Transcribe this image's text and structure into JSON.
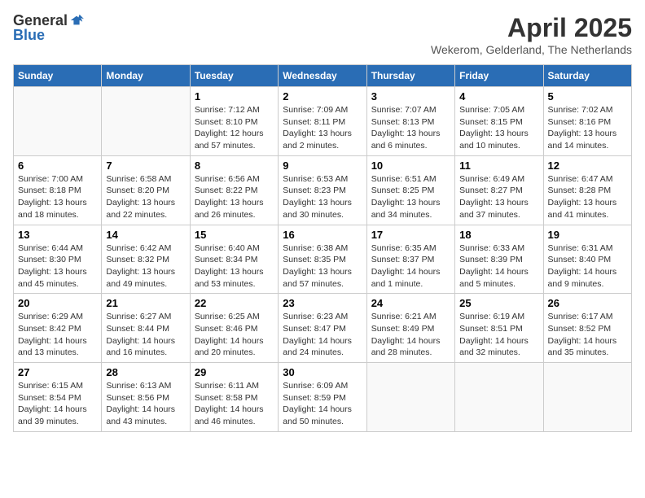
{
  "logo": {
    "general": "General",
    "blue": "Blue"
  },
  "title": "April 2025",
  "subtitle": "Wekerom, Gelderland, The Netherlands",
  "weekdays": [
    "Sunday",
    "Monday",
    "Tuesday",
    "Wednesday",
    "Thursday",
    "Friday",
    "Saturday"
  ],
  "weeks": [
    [
      {
        "day": "",
        "sunrise": "",
        "sunset": "",
        "daylight": ""
      },
      {
        "day": "",
        "sunrise": "",
        "sunset": "",
        "daylight": ""
      },
      {
        "day": "1",
        "sunrise": "Sunrise: 7:12 AM",
        "sunset": "Sunset: 8:10 PM",
        "daylight": "Daylight: 12 hours and 57 minutes."
      },
      {
        "day": "2",
        "sunrise": "Sunrise: 7:09 AM",
        "sunset": "Sunset: 8:11 PM",
        "daylight": "Daylight: 13 hours and 2 minutes."
      },
      {
        "day": "3",
        "sunrise": "Sunrise: 7:07 AM",
        "sunset": "Sunset: 8:13 PM",
        "daylight": "Daylight: 13 hours and 6 minutes."
      },
      {
        "day": "4",
        "sunrise": "Sunrise: 7:05 AM",
        "sunset": "Sunset: 8:15 PM",
        "daylight": "Daylight: 13 hours and 10 minutes."
      },
      {
        "day": "5",
        "sunrise": "Sunrise: 7:02 AM",
        "sunset": "Sunset: 8:16 PM",
        "daylight": "Daylight: 13 hours and 14 minutes."
      }
    ],
    [
      {
        "day": "6",
        "sunrise": "Sunrise: 7:00 AM",
        "sunset": "Sunset: 8:18 PM",
        "daylight": "Daylight: 13 hours and 18 minutes."
      },
      {
        "day": "7",
        "sunrise": "Sunrise: 6:58 AM",
        "sunset": "Sunset: 8:20 PM",
        "daylight": "Daylight: 13 hours and 22 minutes."
      },
      {
        "day": "8",
        "sunrise": "Sunrise: 6:56 AM",
        "sunset": "Sunset: 8:22 PM",
        "daylight": "Daylight: 13 hours and 26 minutes."
      },
      {
        "day": "9",
        "sunrise": "Sunrise: 6:53 AM",
        "sunset": "Sunset: 8:23 PM",
        "daylight": "Daylight: 13 hours and 30 minutes."
      },
      {
        "day": "10",
        "sunrise": "Sunrise: 6:51 AM",
        "sunset": "Sunset: 8:25 PM",
        "daylight": "Daylight: 13 hours and 34 minutes."
      },
      {
        "day": "11",
        "sunrise": "Sunrise: 6:49 AM",
        "sunset": "Sunset: 8:27 PM",
        "daylight": "Daylight: 13 hours and 37 minutes."
      },
      {
        "day": "12",
        "sunrise": "Sunrise: 6:47 AM",
        "sunset": "Sunset: 8:28 PM",
        "daylight": "Daylight: 13 hours and 41 minutes."
      }
    ],
    [
      {
        "day": "13",
        "sunrise": "Sunrise: 6:44 AM",
        "sunset": "Sunset: 8:30 PM",
        "daylight": "Daylight: 13 hours and 45 minutes."
      },
      {
        "day": "14",
        "sunrise": "Sunrise: 6:42 AM",
        "sunset": "Sunset: 8:32 PM",
        "daylight": "Daylight: 13 hours and 49 minutes."
      },
      {
        "day": "15",
        "sunrise": "Sunrise: 6:40 AM",
        "sunset": "Sunset: 8:34 PM",
        "daylight": "Daylight: 13 hours and 53 minutes."
      },
      {
        "day": "16",
        "sunrise": "Sunrise: 6:38 AM",
        "sunset": "Sunset: 8:35 PM",
        "daylight": "Daylight: 13 hours and 57 minutes."
      },
      {
        "day": "17",
        "sunrise": "Sunrise: 6:35 AM",
        "sunset": "Sunset: 8:37 PM",
        "daylight": "Daylight: 14 hours and 1 minute."
      },
      {
        "day": "18",
        "sunrise": "Sunrise: 6:33 AM",
        "sunset": "Sunset: 8:39 PM",
        "daylight": "Daylight: 14 hours and 5 minutes."
      },
      {
        "day": "19",
        "sunrise": "Sunrise: 6:31 AM",
        "sunset": "Sunset: 8:40 PM",
        "daylight": "Daylight: 14 hours and 9 minutes."
      }
    ],
    [
      {
        "day": "20",
        "sunrise": "Sunrise: 6:29 AM",
        "sunset": "Sunset: 8:42 PM",
        "daylight": "Daylight: 14 hours and 13 minutes."
      },
      {
        "day": "21",
        "sunrise": "Sunrise: 6:27 AM",
        "sunset": "Sunset: 8:44 PM",
        "daylight": "Daylight: 14 hours and 16 minutes."
      },
      {
        "day": "22",
        "sunrise": "Sunrise: 6:25 AM",
        "sunset": "Sunset: 8:46 PM",
        "daylight": "Daylight: 14 hours and 20 minutes."
      },
      {
        "day": "23",
        "sunrise": "Sunrise: 6:23 AM",
        "sunset": "Sunset: 8:47 PM",
        "daylight": "Daylight: 14 hours and 24 minutes."
      },
      {
        "day": "24",
        "sunrise": "Sunrise: 6:21 AM",
        "sunset": "Sunset: 8:49 PM",
        "daylight": "Daylight: 14 hours and 28 minutes."
      },
      {
        "day": "25",
        "sunrise": "Sunrise: 6:19 AM",
        "sunset": "Sunset: 8:51 PM",
        "daylight": "Daylight: 14 hours and 32 minutes."
      },
      {
        "day": "26",
        "sunrise": "Sunrise: 6:17 AM",
        "sunset": "Sunset: 8:52 PM",
        "daylight": "Daylight: 14 hours and 35 minutes."
      }
    ],
    [
      {
        "day": "27",
        "sunrise": "Sunrise: 6:15 AM",
        "sunset": "Sunset: 8:54 PM",
        "daylight": "Daylight: 14 hours and 39 minutes."
      },
      {
        "day": "28",
        "sunrise": "Sunrise: 6:13 AM",
        "sunset": "Sunset: 8:56 PM",
        "daylight": "Daylight: 14 hours and 43 minutes."
      },
      {
        "day": "29",
        "sunrise": "Sunrise: 6:11 AM",
        "sunset": "Sunset: 8:58 PM",
        "daylight": "Daylight: 14 hours and 46 minutes."
      },
      {
        "day": "30",
        "sunrise": "Sunrise: 6:09 AM",
        "sunset": "Sunset: 8:59 PM",
        "daylight": "Daylight: 14 hours and 50 minutes."
      },
      {
        "day": "",
        "sunrise": "",
        "sunset": "",
        "daylight": ""
      },
      {
        "day": "",
        "sunrise": "",
        "sunset": "",
        "daylight": ""
      },
      {
        "day": "",
        "sunrise": "",
        "sunset": "",
        "daylight": ""
      }
    ]
  ]
}
